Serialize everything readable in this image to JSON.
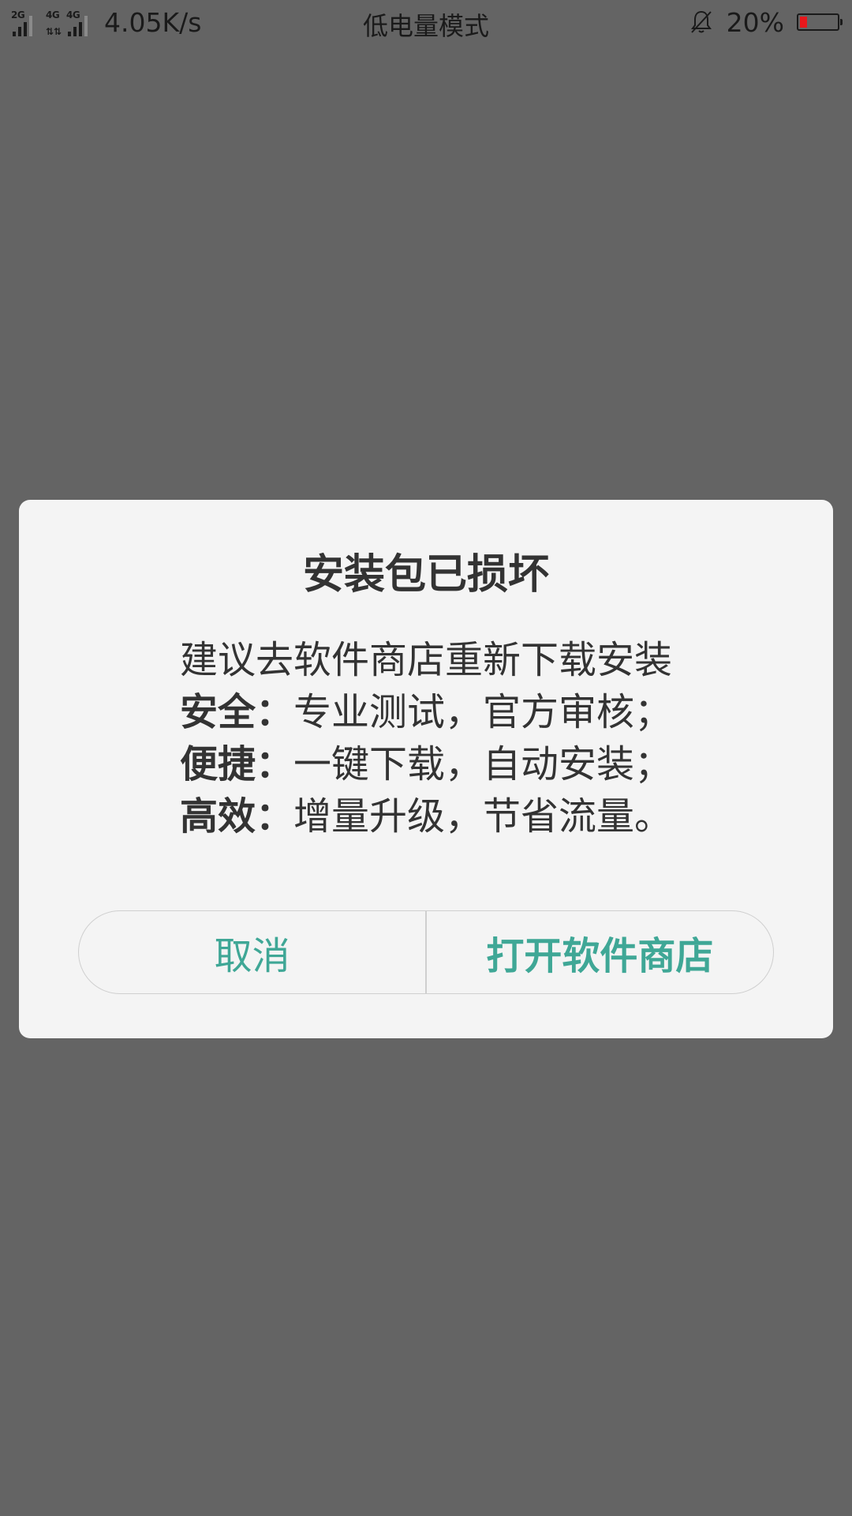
{
  "status_bar": {
    "network_1": "2G",
    "network_2": "4G",
    "network_3": "4G",
    "speed": "4.05K/s",
    "mode": "低电量模式",
    "battery_percent": "20%",
    "battery_level": 0.2,
    "battery_color": "#e8171b",
    "icons": [
      "signal-icon",
      "signal-icon",
      "data-arrows-icon",
      "bell-muted-icon",
      "battery-icon"
    ]
  },
  "dialog": {
    "title": "安装包已损坏",
    "message": "建议去软件商店重新下载安装",
    "features": [
      {
        "label": "安全：",
        "text": "专业测试，官方审核；"
      },
      {
        "label": "便捷：",
        "text": "一键下载，自动安装；"
      },
      {
        "label": "高效：",
        "text": "增量升级，节省流量。"
      }
    ],
    "cancel_label": "取消",
    "open_store_label": "打开软件商店",
    "accent_color": "#3fa796"
  }
}
